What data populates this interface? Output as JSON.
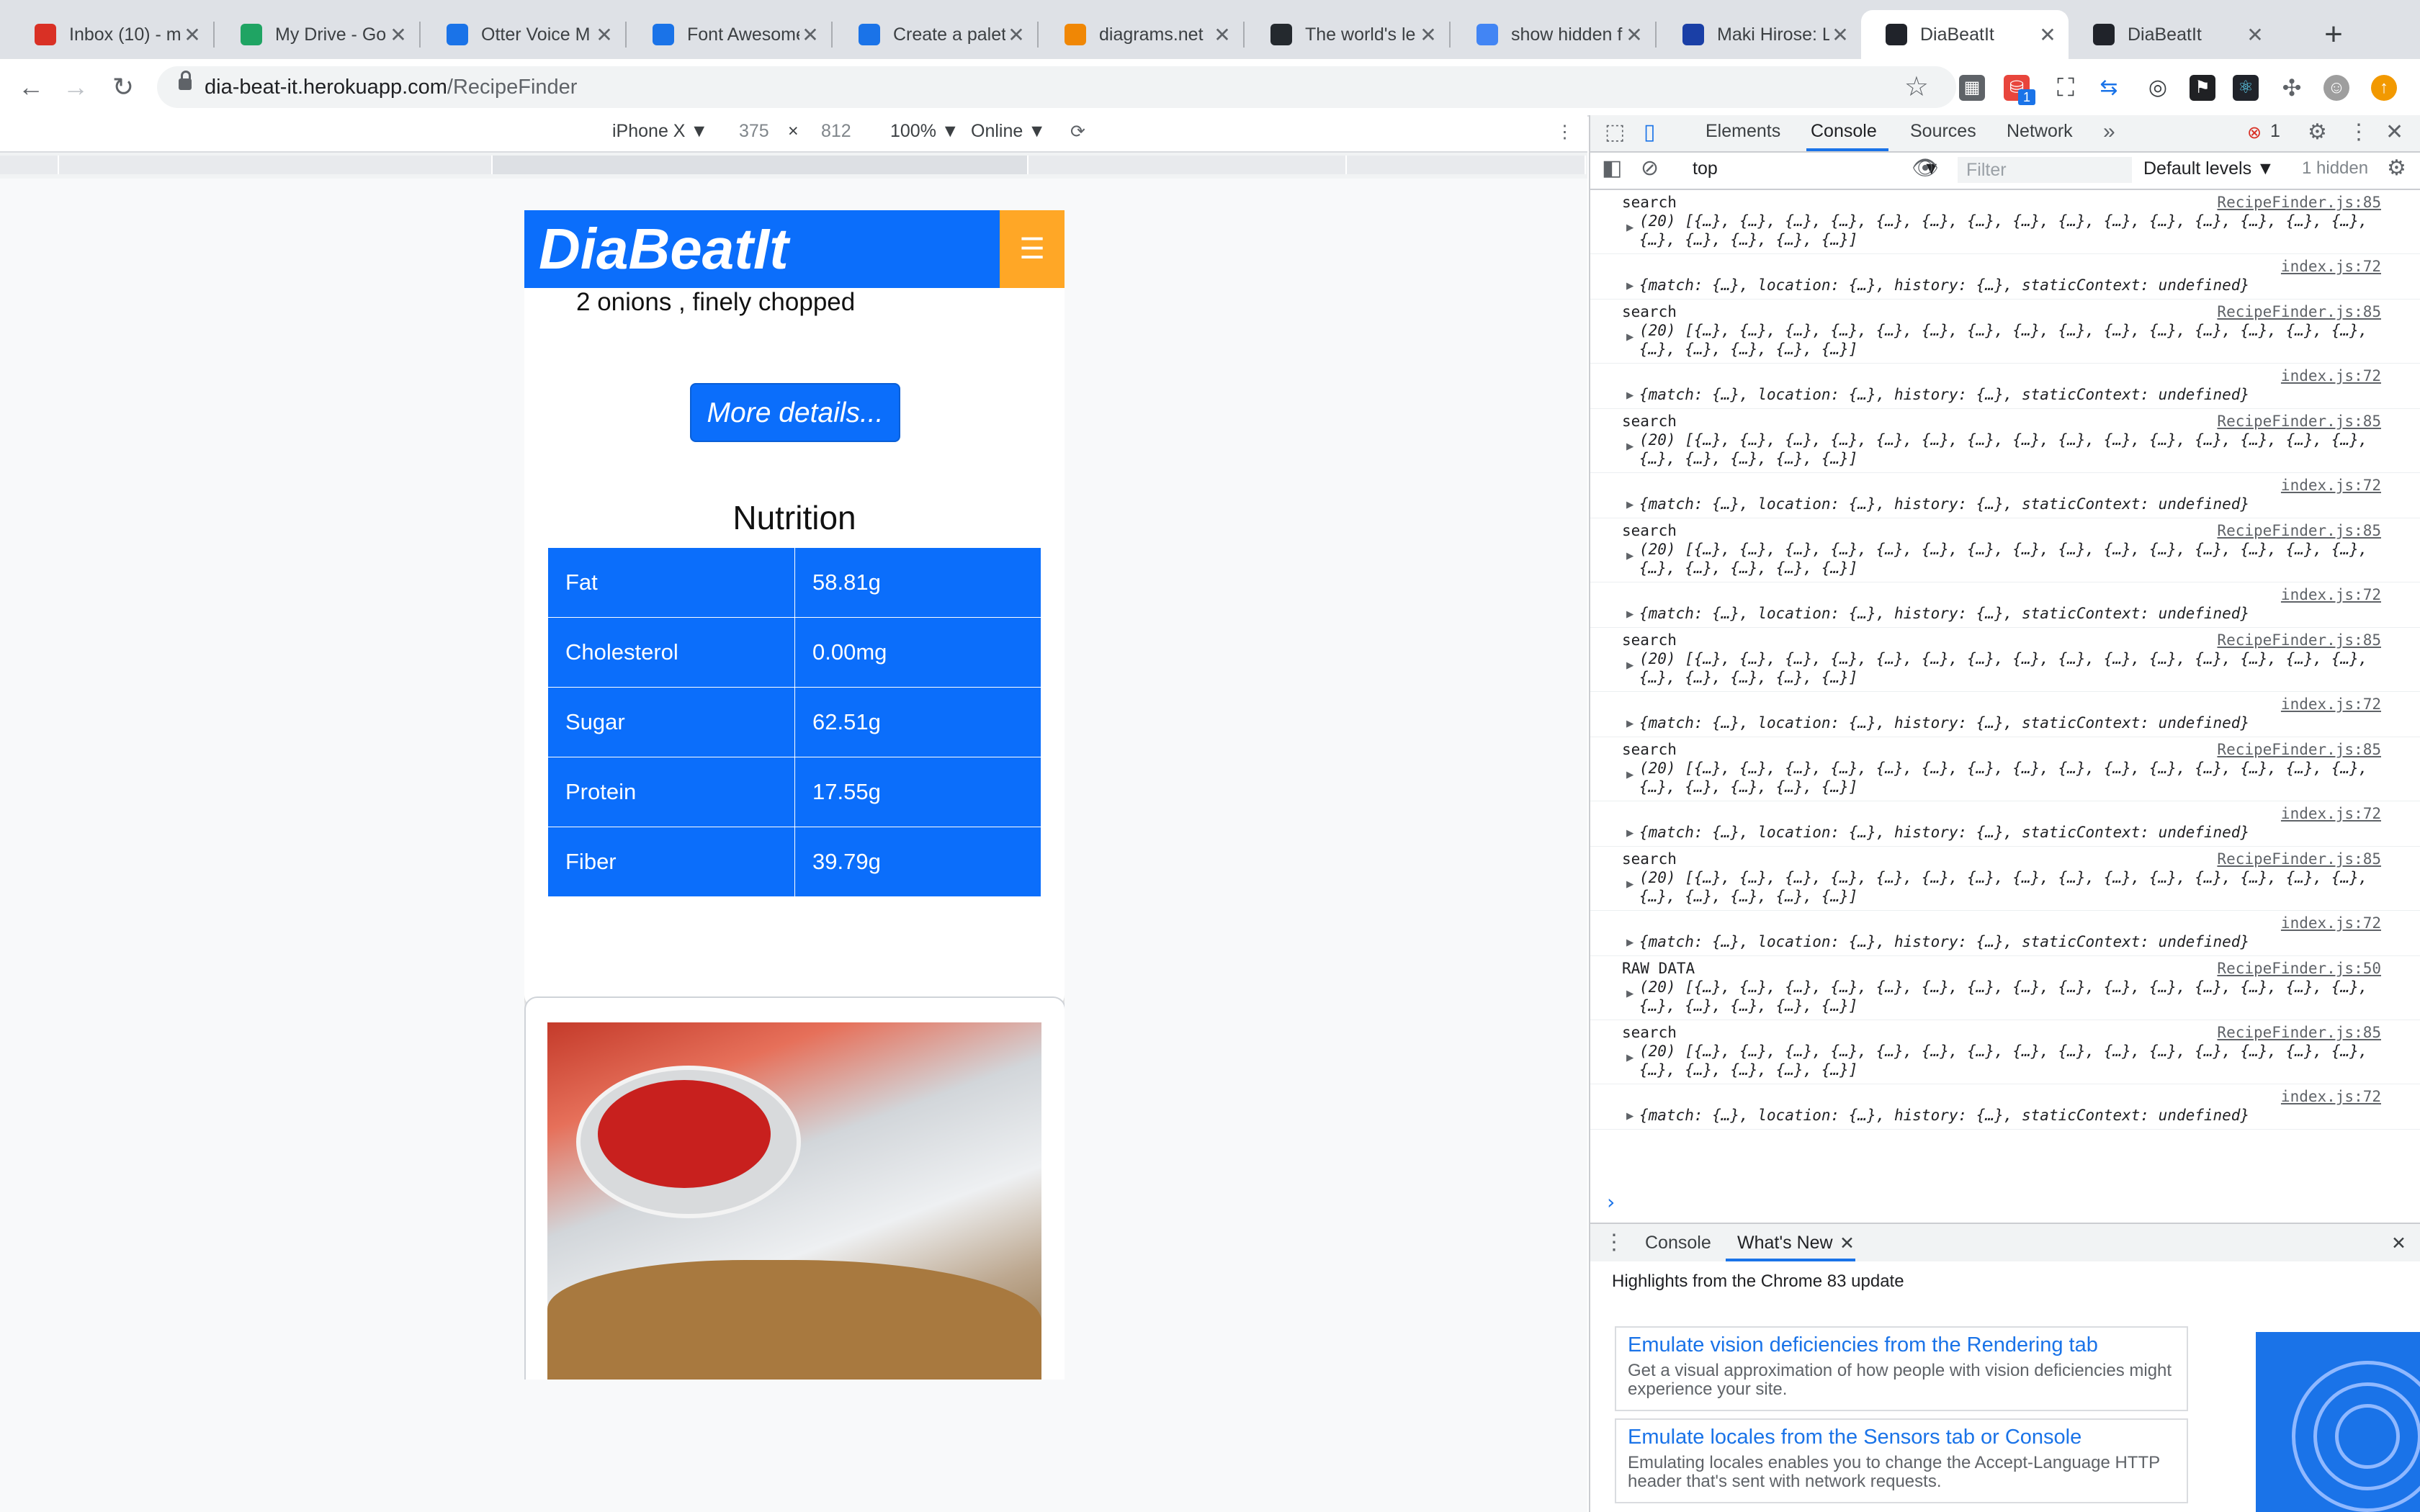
{
  "browser": {
    "tabs": [
      {
        "title": "Inbox (10) - m",
        "icon": "gmail-icon",
        "color": "#d93025"
      },
      {
        "title": "My Drive - Go",
        "icon": "google-drive-icon",
        "color": "#1fa463"
      },
      {
        "title": "Otter Voice M",
        "icon": "otter-icon",
        "color": "#1a73e8"
      },
      {
        "title": "Font Awesome",
        "icon": "font-awesome-flag-icon",
        "color": "#1a73e8"
      },
      {
        "title": "Create a palet",
        "icon": "coolors-icon",
        "color": "#1a73e8"
      },
      {
        "title": "diagrams.net",
        "icon": "drawio-icon",
        "color": "#f08705"
      },
      {
        "title": "The world's le",
        "icon": "github-icon",
        "color": "#24292e"
      },
      {
        "title": "show hidden f",
        "icon": "google-icon",
        "color": "#4285f4"
      },
      {
        "title": "Maki Hirose: L",
        "icon": "portfolio-icon",
        "color": "#1a3fa6"
      },
      {
        "title": "DiaBeatIt",
        "icon": "react-icon",
        "color": "#20232a"
      },
      {
        "title": "DiaBeatIt",
        "icon": "react-icon",
        "color": "#20232a"
      }
    ],
    "active_tab_index": 9,
    "url_host": "dia-beat-it.herokuapp.com",
    "url_path": "/RecipeFinder",
    "extension_badge": "1"
  },
  "device_toolbar": {
    "device": "iPhone X ▼",
    "width": "375",
    "times": "×",
    "height": "812",
    "zoom": "100% ▼",
    "network": "Online ▼"
  },
  "app": {
    "brand": "DiaBeatIt",
    "ingredient_line": "2 onions , finely chopped",
    "more_details_label": "More details...",
    "nutrition_title": "Nutrition",
    "nutrition": [
      {
        "name": "Fat",
        "value": "58.81g"
      },
      {
        "name": "Cholesterol",
        "value": "0.00mg"
      },
      {
        "name": "Sugar",
        "value": "62.51g"
      },
      {
        "name": "Protein",
        "value": "17.55g"
      },
      {
        "name": "Fiber",
        "value": "39.79g"
      }
    ],
    "colors": {
      "primary": "#0b6efb",
      "accent": "#ffa726"
    }
  },
  "devtools": {
    "tabs": [
      "Elements",
      "Console",
      "Sources",
      "Network"
    ],
    "selected_tab": "Console",
    "error_count": "1",
    "context": "top",
    "filter_placeholder": "Filter",
    "levels": "Default levels ▼",
    "hidden": "1 hidden",
    "messages": [
      {
        "label": "search",
        "src": "RecipeFinder.js:85",
        "body": "(20) [{…}, {…}, {…}, {…}, {…}, {…}, {…}, {…}, {…}, {…}, {…}, {…}, {…}, {…}, {…},\n{…}, {…}, {…}, {…}, {…}]"
      },
      {
        "label": "",
        "src": "index.js:72",
        "body": "{match: {…}, location: {…}, history: {…}, staticContext: undefined}"
      },
      {
        "label": "search",
        "src": "RecipeFinder.js:85",
        "body": "(20) [{…}, {…}, {…}, {…}, {…}, {…}, {…}, {…}, {…}, {…}, {…}, {…}, {…}, {…}, {…},\n{…}, {…}, {…}, {…}, {…}]"
      },
      {
        "label": "",
        "src": "index.js:72",
        "body": "{match: {…}, location: {…}, history: {…}, staticContext: undefined}"
      },
      {
        "label": "search",
        "src": "RecipeFinder.js:85",
        "body": "(20) [{…}, {…}, {…}, {…}, {…}, {…}, {…}, {…}, {…}, {…}, {…}, {…}, {…}, {…}, {…},\n{…}, {…}, {…}, {…}, {…}]"
      },
      {
        "label": "",
        "src": "index.js:72",
        "body": "{match: {…}, location: {…}, history: {…}, staticContext: undefined}"
      },
      {
        "label": "search",
        "src": "RecipeFinder.js:85",
        "body": "(20) [{…}, {…}, {…}, {…}, {…}, {…}, {…}, {…}, {…}, {…}, {…}, {…}, {…}, {…}, {…},\n{…}, {…}, {…}, {…}, {…}]"
      },
      {
        "label": "",
        "src": "index.js:72",
        "body": "{match: {…}, location: {…}, history: {…}, staticContext: undefined}"
      },
      {
        "label": "search",
        "src": "RecipeFinder.js:85",
        "body": "(20) [{…}, {…}, {…}, {…}, {…}, {…}, {…}, {…}, {…}, {…}, {…}, {…}, {…}, {…}, {…},\n{…}, {…}, {…}, {…}, {…}]"
      },
      {
        "label": "",
        "src": "index.js:72",
        "body": "{match: {…}, location: {…}, history: {…}, staticContext: undefined}"
      },
      {
        "label": "search",
        "src": "RecipeFinder.js:85",
        "body": "(20) [{…}, {…}, {…}, {…}, {…}, {…}, {…}, {…}, {…}, {…}, {…}, {…}, {…}, {…}, {…},\n{…}, {…}, {…}, {…}, {…}]"
      },
      {
        "label": "",
        "src": "index.js:72",
        "body": "{match: {…}, location: {…}, history: {…}, staticContext: undefined}"
      },
      {
        "label": "search",
        "src": "RecipeFinder.js:85",
        "body": "(20) [{…}, {…}, {…}, {…}, {…}, {…}, {…}, {…}, {…}, {…}, {…}, {…}, {…}, {…}, {…},\n{…}, {…}, {…}, {…}, {…}]"
      },
      {
        "label": "",
        "src": "index.js:72",
        "body": "{match: {…}, location: {…}, history: {…}, staticContext: undefined}"
      },
      {
        "label": "RAW DATA",
        "src": "RecipeFinder.js:50",
        "body": "(20) [{…}, {…}, {…}, {…}, {…}, {…}, {…}, {…}, {…}, {…}, {…}, {…}, {…}, {…}, {…},\n{…}, {…}, {…}, {…}, {…}]"
      },
      {
        "label": "search",
        "src": "RecipeFinder.js:85",
        "body": "(20) [{…}, {…}, {…}, {…}, {…}, {…}, {…}, {…}, {…}, {…}, {…}, {…}, {…}, {…}, {…},\n{…}, {…}, {…}, {…}, {…}]"
      },
      {
        "label": "",
        "src": "index.js:72",
        "body": "{match: {…}, location: {…}, history: {…}, staticContext: undefined}"
      }
    ],
    "prompt": "›",
    "drawer_tabs": [
      "Console",
      "What's New"
    ],
    "whats_new_heading": "Highlights from the Chrome 83 update",
    "whats_new_items": [
      {
        "title": "Emulate vision deficiencies from the Rendering tab",
        "desc": "Get a visual approximation of how people with vision deficiencies might experience your site."
      },
      {
        "title": "Emulate locales from the Sensors tab or Console",
        "desc": "Emulating locales enables you to change the Accept-Language HTTP header that's sent with network requests."
      }
    ]
  }
}
